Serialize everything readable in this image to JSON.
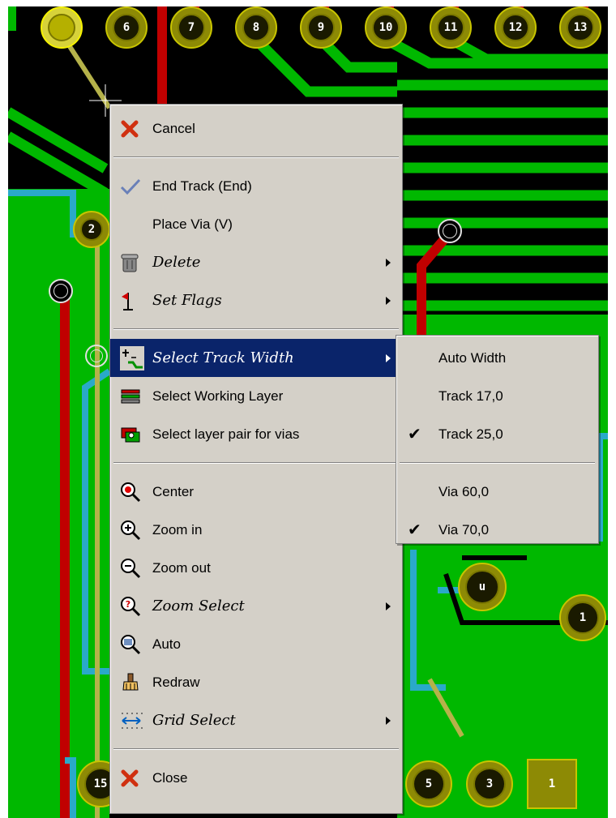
{
  "board": {
    "top_pins": [
      "6",
      "7",
      "8",
      "9",
      "10",
      "11",
      "12",
      "13"
    ],
    "left_pin": "2",
    "bottom_pins": [
      "15",
      "5",
      "3",
      "1"
    ],
    "mid_pins": [
      "u",
      "1"
    ]
  },
  "menu": {
    "items": [
      {
        "label": "Cancel",
        "icon": "cancel-x-icon"
      },
      {
        "label": "End Track (End)",
        "icon": "checkmark-icon"
      },
      {
        "label": "Place Via (V)",
        "icon": ""
      },
      {
        "label": "Delete",
        "icon": "trash-can-icon",
        "submenu": true
      },
      {
        "label": "Set Flags",
        "icon": "flag-icon",
        "submenu": true
      },
      {
        "label": "Select Track Width",
        "icon": "track-width-icon",
        "submenu": true,
        "highlighted": true
      },
      {
        "label": "Select Working Layer",
        "icon": "layers-icon"
      },
      {
        "label": "Select layer pair for vias",
        "icon": "layer-pair-icon"
      },
      {
        "label": "Center",
        "icon": "center-zoom-icon"
      },
      {
        "label": "Zoom in",
        "icon": "zoom-in-icon"
      },
      {
        "label": "Zoom out",
        "icon": "zoom-out-icon"
      },
      {
        "label": "Zoom Select",
        "icon": "zoom-select-icon",
        "submenu": true
      },
      {
        "label": "Auto",
        "icon": "zoom-auto-icon"
      },
      {
        "label": "Redraw",
        "icon": "redraw-brush-icon"
      },
      {
        "label": "Grid Select",
        "icon": "grid-icon",
        "submenu": true
      },
      {
        "label": "Close",
        "icon": "close-x-icon"
      }
    ]
  },
  "submenu": {
    "items": [
      {
        "label": "Auto Width",
        "checked": false
      },
      {
        "label": "Track 17,0",
        "checked": false
      },
      {
        "label": "Track 25,0",
        "checked": true
      },
      {
        "label": "Via 60,0",
        "checked": false
      },
      {
        "label": "Via 70,0",
        "checked": true
      }
    ],
    "check_glyph": "✔"
  },
  "colors": {
    "copper_green": "#00b800",
    "copper_red": "#c00000",
    "pad_yellow": "#8d8a05",
    "trace_cyan": "#2aa9c9",
    "menu_bg": "#d4d0c8",
    "highlight": "#0a246a"
  }
}
